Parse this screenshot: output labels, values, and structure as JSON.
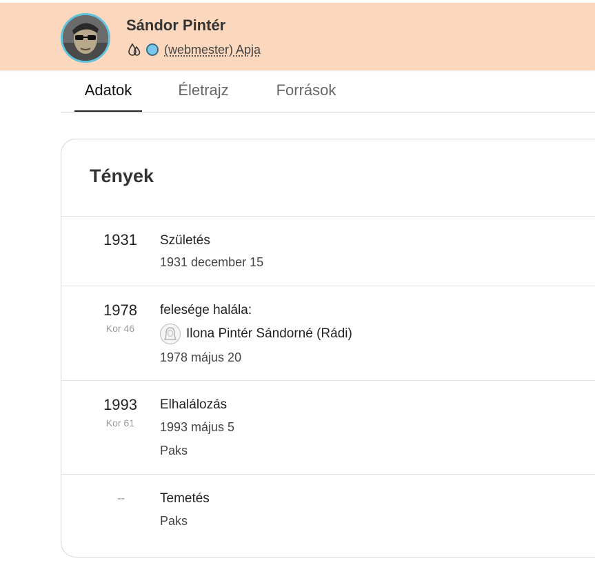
{
  "profile": {
    "name": "Sándor Pintér",
    "relation": "(webmester) Apja",
    "icons": [
      "drops-icon",
      "status-dot"
    ],
    "accent_color": "#fbd8bd",
    "avatar_ring_color": "#5fc3dd"
  },
  "tabs": [
    {
      "label": "Adatok",
      "active": true
    },
    {
      "label": "Életrajz",
      "active": false
    },
    {
      "label": "Források",
      "active": false
    }
  ],
  "facts": {
    "title": "Tények",
    "events": [
      {
        "year": "1931",
        "title": "Születés",
        "date": "1931 december 15"
      },
      {
        "year": "1978",
        "age": "Kor 46",
        "title": "felesége halála:",
        "person": "Ilona Pintér Sándorné (Rádi)",
        "date": "1978 május 20"
      },
      {
        "year": "1993",
        "age": "Kor 61",
        "title": "Elhalálozás",
        "date": "1993 május 5",
        "place": "Paks"
      },
      {
        "year": "--",
        "title": "Temetés",
        "place": "Paks"
      }
    ]
  }
}
